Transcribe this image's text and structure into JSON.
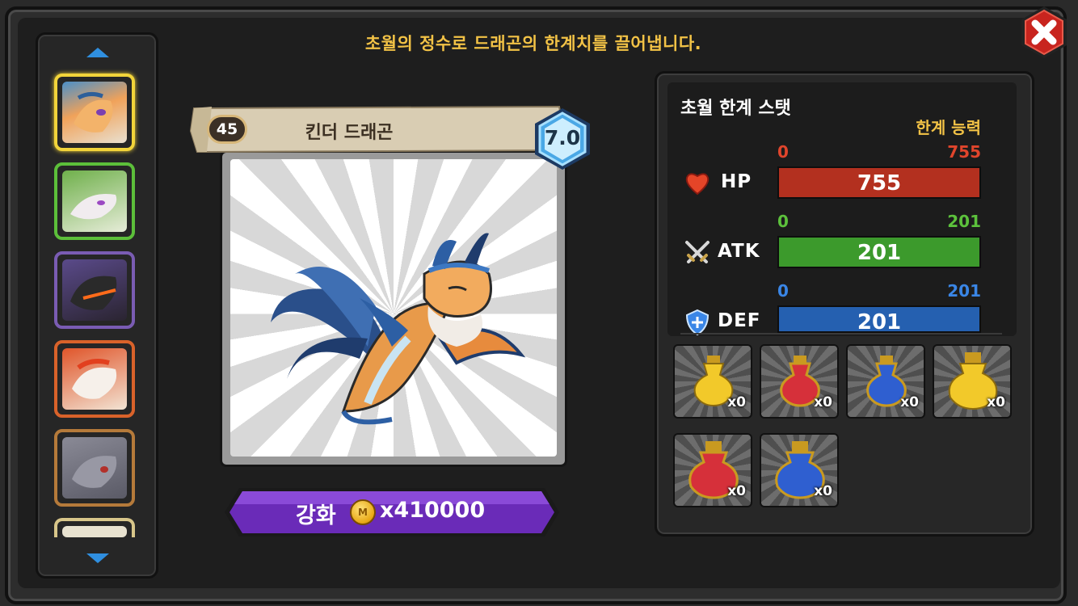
{
  "header": {
    "message": "초월의 정수로 드래곤의 한계치를 끌어냅니다."
  },
  "dragon": {
    "level": "45",
    "name": "킨더 드래곤",
    "grade": "7.0"
  },
  "upgrade": {
    "label": "강화",
    "coin_symbol": "M",
    "cost": "x410000"
  },
  "stats": {
    "title": "초월 한계 스탯",
    "limit_label": "한계 능력",
    "hp": {
      "label": "HP",
      "min": "0",
      "max": "755",
      "value": "755",
      "fill": 1.0,
      "color": "#b3301f",
      "text_color": "#e0452c"
    },
    "atk": {
      "label": "ATK",
      "min": "0",
      "max": "201",
      "value": "201",
      "fill": 1.0,
      "color": "#3c9a2c",
      "text_color": "#5cc13c"
    },
    "def": {
      "label": "DEF",
      "min": "0",
      "max": "201",
      "value": "201",
      "fill": 1.0,
      "color": "#2560b0",
      "text_color": "#3a86e6"
    }
  },
  "items": [
    {
      "name": "yellow-essence",
      "count": "x0"
    },
    {
      "name": "red-essence",
      "count": "x0"
    },
    {
      "name": "blue-essence",
      "count": "x0"
    },
    {
      "name": "large-yellow-essence",
      "count": "x0"
    },
    {
      "name": "large-red-essence",
      "count": "x0"
    },
    {
      "name": "large-blue-essence",
      "count": "x0"
    }
  ],
  "icons": {
    "close": "close-icon",
    "up": "arrow-up-icon",
    "down": "arrow-down-icon",
    "hp": "heart-icon",
    "atk": "crossed-swords-icon",
    "def": "shield-icon",
    "coin": "coin-icon"
  }
}
